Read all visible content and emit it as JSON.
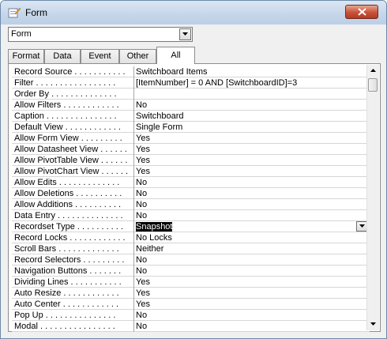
{
  "window": {
    "title": "Form",
    "icon": "form-pencil-icon"
  },
  "selector": {
    "value": "Form"
  },
  "tabs": [
    {
      "label": "Format"
    },
    {
      "label": "Data"
    },
    {
      "label": "Event"
    },
    {
      "label": "Other"
    },
    {
      "label": "All",
      "active": true
    }
  ],
  "properties": [
    {
      "name": "Record Source . . . . . . . . . . .",
      "value": "Switchboard Items"
    },
    {
      "name": "Filter . . . . . . . . . . . . . . . . .",
      "value": "[ItemNumber] = 0 AND [SwitchboardID]=3"
    },
    {
      "name": "Order By . . . . . . . . . . . . . .",
      "value": ""
    },
    {
      "name": "Allow Filters . . . . . . . . . . . .",
      "value": "No"
    },
    {
      "name": "Caption . . . . . . . . . . . . . . .",
      "value": "Switchboard"
    },
    {
      "name": "Default View . . . . . . . . . . . .",
      "value": "Single Form"
    },
    {
      "name": "Allow Form View . . . . . . . . .",
      "value": "Yes"
    },
    {
      "name": "Allow Datasheet View . . . . . .",
      "value": "Yes"
    },
    {
      "name": "Allow PivotTable View . . . . . .",
      "value": "Yes"
    },
    {
      "name": "Allow PivotChart View . . . . . .",
      "value": "Yes"
    },
    {
      "name": "Allow Edits . . . . . . . . . . . . .",
      "value": "No"
    },
    {
      "name": "Allow Deletions . . . . . . . . . .",
      "value": "No"
    },
    {
      "name": "Allow Additions . . . . . . . . . .",
      "value": "No"
    },
    {
      "name": "Data Entry . . . . . . . . . . . . . .",
      "value": "No"
    },
    {
      "name": "Recordset Type . . . . . . . . . .",
      "value": "Snapshot",
      "selected": true
    },
    {
      "name": "Record Locks . . . . . . . . . . . .",
      "value": "No Locks"
    },
    {
      "name": "Scroll Bars . . . . . . . . . . . . .",
      "value": "Neither"
    },
    {
      "name": "Record Selectors . . . . . . . . .",
      "value": "No"
    },
    {
      "name": "Navigation Buttons . . . . . . .",
      "value": "No"
    },
    {
      "name": "Dividing Lines . . . . . . . . . . .",
      "value": "Yes"
    },
    {
      "name": "Auto Resize . . . . . . . . . . . .",
      "value": "Yes"
    },
    {
      "name": "Auto Center . . . . . . . . . . . .",
      "value": "Yes"
    },
    {
      "name": "Pop Up . . . . . . . . . . . . . . .",
      "value": "No"
    },
    {
      "name": "Modal . . . . . . . . . . . . . . . .",
      "value": "No"
    }
  ]
}
